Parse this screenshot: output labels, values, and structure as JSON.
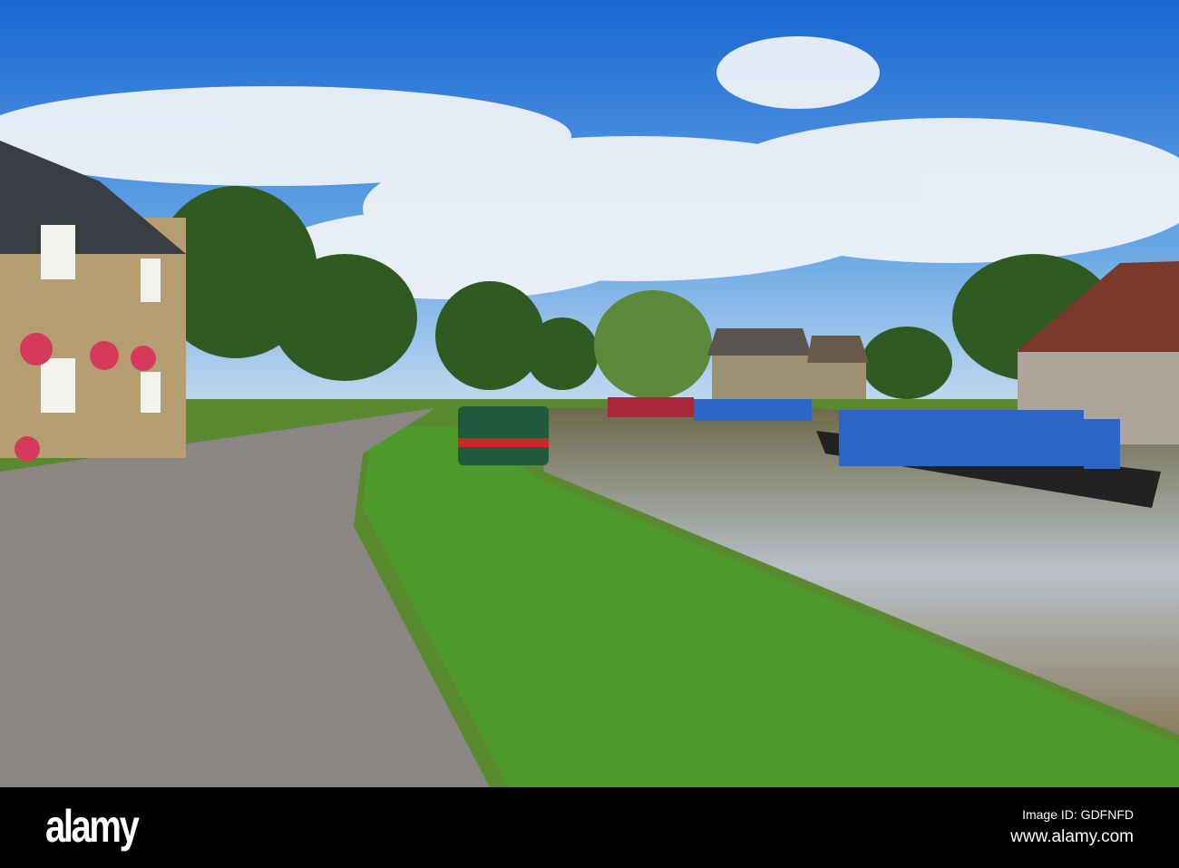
{
  "footer": {
    "logo": "alamy",
    "image_id": "Image ID: GDFNFD",
    "website": "www.alamy.com"
  },
  "colors": {
    "sky_top": "#1f6fd6",
    "sky_bottom": "#9cc6ea",
    "grass": "#4f9a2c",
    "water": "#8a8a6a",
    "path": "#8a8684",
    "boat_blue": "#2a66c8",
    "boat_green": "#1f5a3c"
  }
}
